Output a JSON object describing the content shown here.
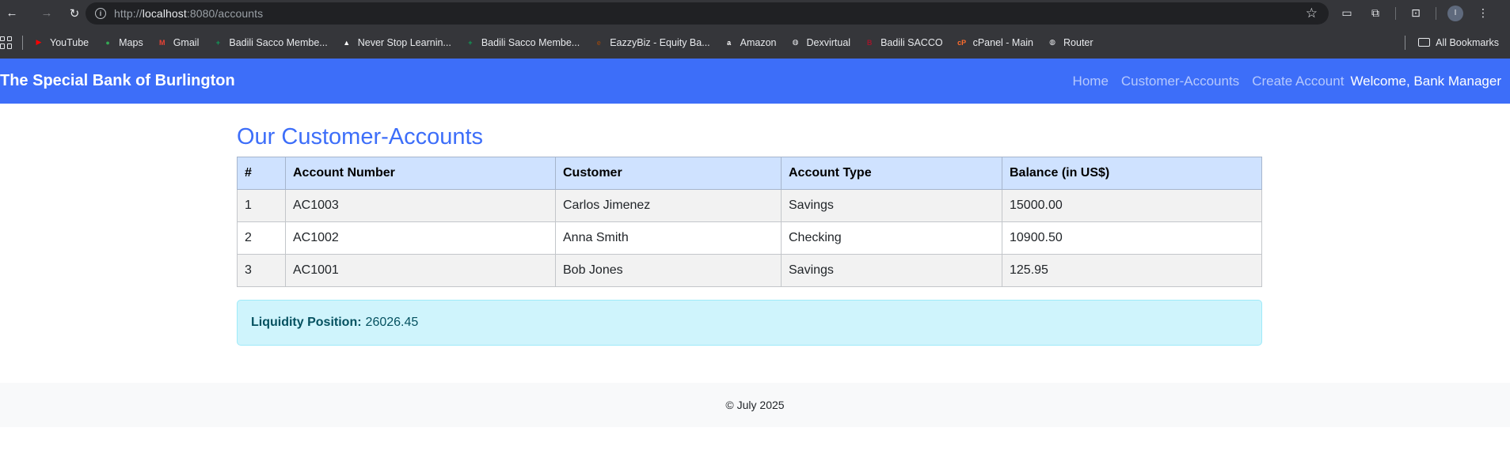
{
  "browser": {
    "url_scheme": "http://",
    "url_host": "localhost",
    "url_rest": ":8080/accounts",
    "nav_icons": [
      "back-icon",
      "forward-icon",
      "reload-icon"
    ],
    "bookmarks": [
      {
        "label": "YouTube",
        "icon": "youtube-icon",
        "color": "#ff0000",
        "glyph": "▶"
      },
      {
        "label": "Maps",
        "icon": "maps-icon",
        "color": "#34a853",
        "glyph": "●"
      },
      {
        "label": "Gmail",
        "icon": "gmail-icon",
        "color": "#ea4335",
        "glyph": "M"
      },
      {
        "label": "Badili Sacco Membe...",
        "icon": "sheets-icon",
        "color": "#0f9d58",
        "glyph": "+"
      },
      {
        "label": "Never Stop Learnin...",
        "icon": "triangle-logo-icon",
        "color": "#ffffff",
        "glyph": "▲"
      },
      {
        "label": "Badili Sacco Membe...",
        "icon": "sheets-icon",
        "color": "#0f9d58",
        "glyph": "+"
      },
      {
        "label": "EazzyBiz - Equity Ba...",
        "icon": "equity-icon",
        "color": "#8b4513",
        "glyph": "e"
      },
      {
        "label": "Amazon",
        "icon": "amazon-icon",
        "color": "#ffffff",
        "glyph": "a"
      },
      {
        "label": "Dexvirtual",
        "icon": "globe-icon",
        "color": "#e8eaed",
        "glyph": "◍"
      },
      {
        "label": "Badili SACCO",
        "icon": "sacco-icon",
        "color": "#a0152b",
        "glyph": "B"
      },
      {
        "label": "cPanel - Main",
        "icon": "cpanel-icon",
        "color": "#ff6c2c",
        "glyph": "cP"
      },
      {
        "label": "Router",
        "icon": "globe-icon",
        "color": "#e8eaed",
        "glyph": "◍"
      }
    ],
    "all_bookmarks_label": "All Bookmarks",
    "profile_initial": "I"
  },
  "navbar": {
    "brand": "The Special Bank of Burlington",
    "links": [
      "Home",
      "Customer-Accounts",
      "Create Account"
    ],
    "welcome": "Welcome, Bank Manager"
  },
  "main": {
    "title": "Our Customer-Accounts",
    "table": {
      "headers": [
        "#",
        "Account Number",
        "Customer",
        "Account Type",
        "Balance (in US$)"
      ],
      "rows": [
        [
          "1",
          "AC1003",
          "Carlos Jimenez",
          "Savings",
          "15000.00"
        ],
        [
          "2",
          "AC1002",
          "Anna Smith",
          "Checking",
          "10900.50"
        ],
        [
          "3",
          "AC1001",
          "Bob Jones",
          "Savings",
          "125.95"
        ]
      ]
    },
    "liquidity": {
      "label": "Liquidity Position:",
      "value": "26026.45"
    }
  },
  "footer": {
    "text": "© July 2025"
  },
  "colors": {
    "brand_blue": "#3d6ef9",
    "table_header": "#cfe2ff",
    "alert_bg": "#cff4fc"
  }
}
